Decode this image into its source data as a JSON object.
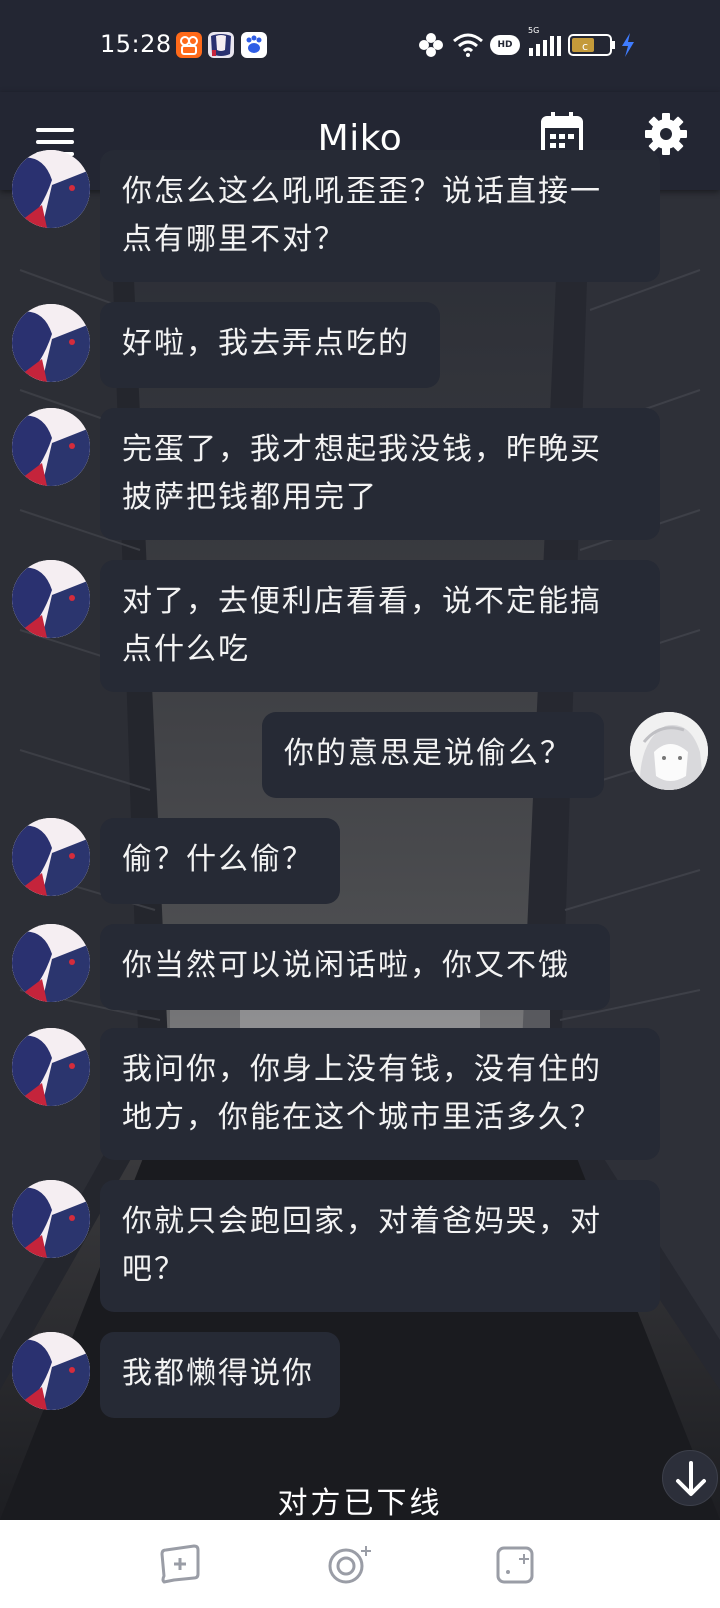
{
  "status_bar": {
    "time": "15:28",
    "app_icons": [
      "kuaishou-icon",
      "character-icon",
      "baidu-icon"
    ],
    "signal_label": "5G",
    "hd_label": "HD"
  },
  "header": {
    "title": "Miko",
    "menu_icon": "menu-icon",
    "calendar_icon": "calendar-icon",
    "settings_icon": "gear-icon"
  },
  "messages": [
    {
      "sender": "bot",
      "lines": [
        "你怎么这么吼吼歪歪？说话直接一",
        "点有哪里不对？"
      ]
    },
    {
      "sender": "bot",
      "lines": [
        "好啦，我去弄点吃的"
      ]
    },
    {
      "sender": "bot",
      "lines": [
        "完蛋了，我才想起我没钱，昨晚买",
        "披萨把钱都用完了"
      ]
    },
    {
      "sender": "bot",
      "lines": [
        "对了，去便利店看看，说不定能搞",
        "点什么吃"
      ]
    },
    {
      "sender": "user",
      "lines": [
        "你的意思是说偷么？"
      ]
    },
    {
      "sender": "bot",
      "lines": [
        "偷？什么偷？"
      ]
    },
    {
      "sender": "bot",
      "lines": [
        "你当然可以说闲话啦，你又不饿"
      ]
    },
    {
      "sender": "bot",
      "lines": [
        "我问你，你身上没有钱，没有住的",
        "地方，你能在这个城市里活多久？"
      ]
    },
    {
      "sender": "bot",
      "lines": [
        "你就只会跑回家，对着爸妈哭，对",
        "吧？"
      ]
    },
    {
      "sender": "bot",
      "lines": [
        "我都懒得说你"
      ]
    }
  ],
  "status_text": "对方已下线",
  "scroll_button_icon": "arrow-down-icon",
  "bottom_bar": {
    "buttons": [
      "chat-bubble-icon",
      "record-icon",
      "add-card-icon"
    ]
  },
  "colors": {
    "header_bg": "#232633",
    "bubble_bg": "#262a35",
    "bottom_bg": "#ffffff"
  }
}
